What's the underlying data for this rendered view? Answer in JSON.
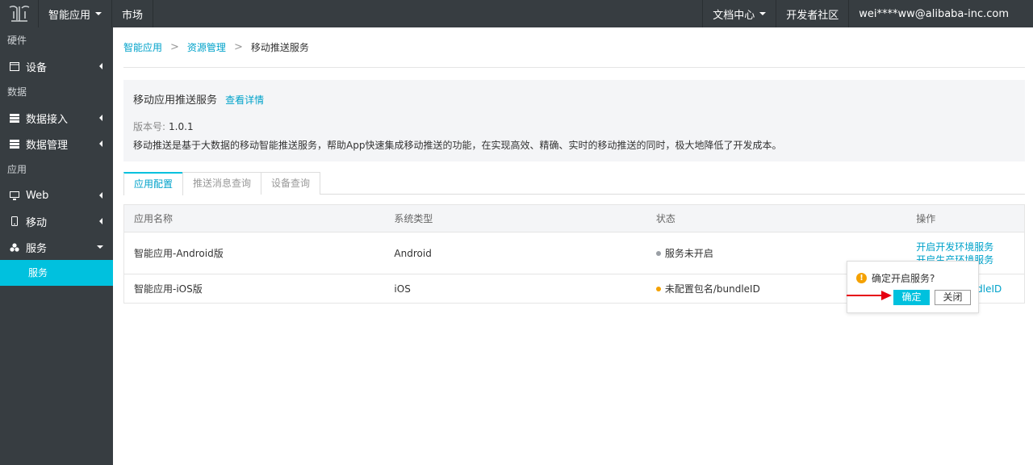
{
  "topbar": {
    "app_menu": "智能应用",
    "market": "市场",
    "docs": "文档中心",
    "community": "开发者社区",
    "user": "wei****ww@alibaba-inc.com",
    "logo_icon": "logo-icon"
  },
  "sidebar": {
    "groups": {
      "hardware": "硬件",
      "data": "数据",
      "app": "应用"
    },
    "items": {
      "device": "设备",
      "data_access": "数据接入",
      "data_manage": "数据管理",
      "web": "Web",
      "mobile": "移动",
      "service": "服务"
    },
    "sub_active": "服务",
    "active_color": "#00c1de"
  },
  "breadcrumb": {
    "items": [
      "智能应用",
      "资源管理",
      "移动推送服务"
    ],
    "separator": ">"
  },
  "info": {
    "title": "移动应用推送服务",
    "detail_link": "查看详情",
    "version_label": "版本号:",
    "version_value": "1.0.1",
    "description": "移动推送是基于大数据的移动智能推送服务，帮助App快速集成移动推送的功能，在实现高效、精确、实时的移动推送的同时，极大地降低了开发成本。"
  },
  "tabs": [
    {
      "label": "应用配置",
      "active": true
    },
    {
      "label": "推送消息查询",
      "active": false
    },
    {
      "label": "设备查询",
      "active": false
    }
  ],
  "table": {
    "headers": [
      "应用名称",
      "系统类型",
      "状态",
      "操作"
    ],
    "rows": [
      {
        "name": "智能应用-Android版",
        "system": "Android",
        "status": "服务未开启",
        "status_color": "#9a9fa5",
        "ops": [
          "开启开发环境服务",
          "开启生产环境服务"
        ]
      },
      {
        "name": "智能应用-iOS版",
        "system": "iOS",
        "status": "未配置包名/bundleID",
        "status_color": "#f4a100",
        "ops": [
          "配置包名/bundleID"
        ]
      }
    ]
  },
  "popover": {
    "message": "确定开启服务?",
    "confirm": "确定",
    "close": "关闭",
    "warn_icon": "warning-icon"
  },
  "colors": {
    "topbar_bg": "#373d41",
    "accent": "#00c1de",
    "link": "#00a2ca",
    "annotation_arrow": "#e60012"
  }
}
